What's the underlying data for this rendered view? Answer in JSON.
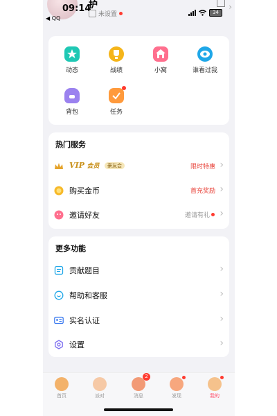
{
  "status_bar": {
    "time": "09:14",
    "back_app": "◀ QQ",
    "battery": "34"
  },
  "profile": {
    "nickname": "护",
    "status_text": "未设置"
  },
  "grid": [
    {
      "label": "动态",
      "icon": "star-icon",
      "color": "#1fc8b4"
    },
    {
      "label": "战绩",
      "icon": "trophy-icon",
      "color": "#f5b51a"
    },
    {
      "label": "小窝",
      "icon": "house-icon",
      "color": "#ff6f8e"
    },
    {
      "label": "谁看过我",
      "icon": "eye-icon",
      "color": "#1fa7e8"
    },
    {
      "label": "背包",
      "icon": "backpack-icon",
      "color": "#9b82ef"
    },
    {
      "label": "任务",
      "icon": "task-icon",
      "color": "#ff9a3c"
    }
  ],
  "hot_services": {
    "title": "热门服务",
    "vip": {
      "label": "VIP",
      "sub": "会员",
      "badge": "豪友会",
      "tag": "限时特惠"
    },
    "coins": {
      "label": "购买金币",
      "tag": "首充奖励"
    },
    "invite": {
      "label": "邀请好友",
      "tag": "邀请有礼"
    }
  },
  "more": {
    "title": "更多功能",
    "items": [
      {
        "label": "贡献题目",
        "icon": "document-icon"
      },
      {
        "label": "帮助和客服",
        "icon": "support-icon"
      },
      {
        "label": "实名认证",
        "icon": "id-card-icon"
      },
      {
        "label": "设置",
        "icon": "settings-icon"
      }
    ]
  },
  "tabs": [
    {
      "label": "首页"
    },
    {
      "label": "派对"
    },
    {
      "label": "消息",
      "badge": "2"
    },
    {
      "label": "发现"
    },
    {
      "label": "我的"
    }
  ],
  "colors": {
    "accent": "#ff4d6a",
    "tag_red": "#e8453c",
    "vip_gold": "#c9901a"
  }
}
